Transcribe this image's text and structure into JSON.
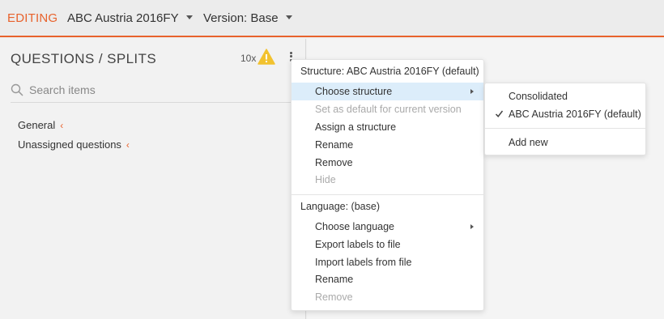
{
  "topbar": {
    "mode_label": "EDITING",
    "project_label": "ABC Austria 2016FY",
    "version_label": "Version: Base"
  },
  "left_panel": {
    "title": "QUESTIONS / SPLITS",
    "warning_count": "10x",
    "search_placeholder": "Search items",
    "tree": [
      {
        "label": "General"
      },
      {
        "label": "Unassigned questions"
      }
    ]
  },
  "context_menu": {
    "structure_header": "Structure: ABC Austria 2016FY (default)",
    "structure_items": [
      {
        "label": "Choose structure",
        "disabled": false,
        "has_submenu": true
      },
      {
        "label": "Set as default for current version",
        "disabled": true
      },
      {
        "label": "Assign a structure",
        "disabled": false
      },
      {
        "label": "Rename",
        "disabled": false
      },
      {
        "label": "Remove",
        "disabled": false
      },
      {
        "label": "Hide",
        "disabled": true
      }
    ],
    "language_header": "Language: (base)",
    "language_items": [
      {
        "label": "Choose language",
        "disabled": false,
        "has_submenu": true
      },
      {
        "label": "Export labels to file",
        "disabled": false
      },
      {
        "label": "Import labels from file",
        "disabled": false
      },
      {
        "label": "Rename",
        "disabled": false
      },
      {
        "label": "Remove",
        "disabled": true
      }
    ]
  },
  "submenu": {
    "items": [
      {
        "label": "Consolidated",
        "checked": false
      },
      {
        "label": "ABC Austria 2016FY (default)",
        "checked": true
      }
    ],
    "add_new_label": "Add new"
  },
  "colors": {
    "accent": "#e8622c",
    "warning": "#f2c22f",
    "menu_highlight": "#dcedfa"
  }
}
